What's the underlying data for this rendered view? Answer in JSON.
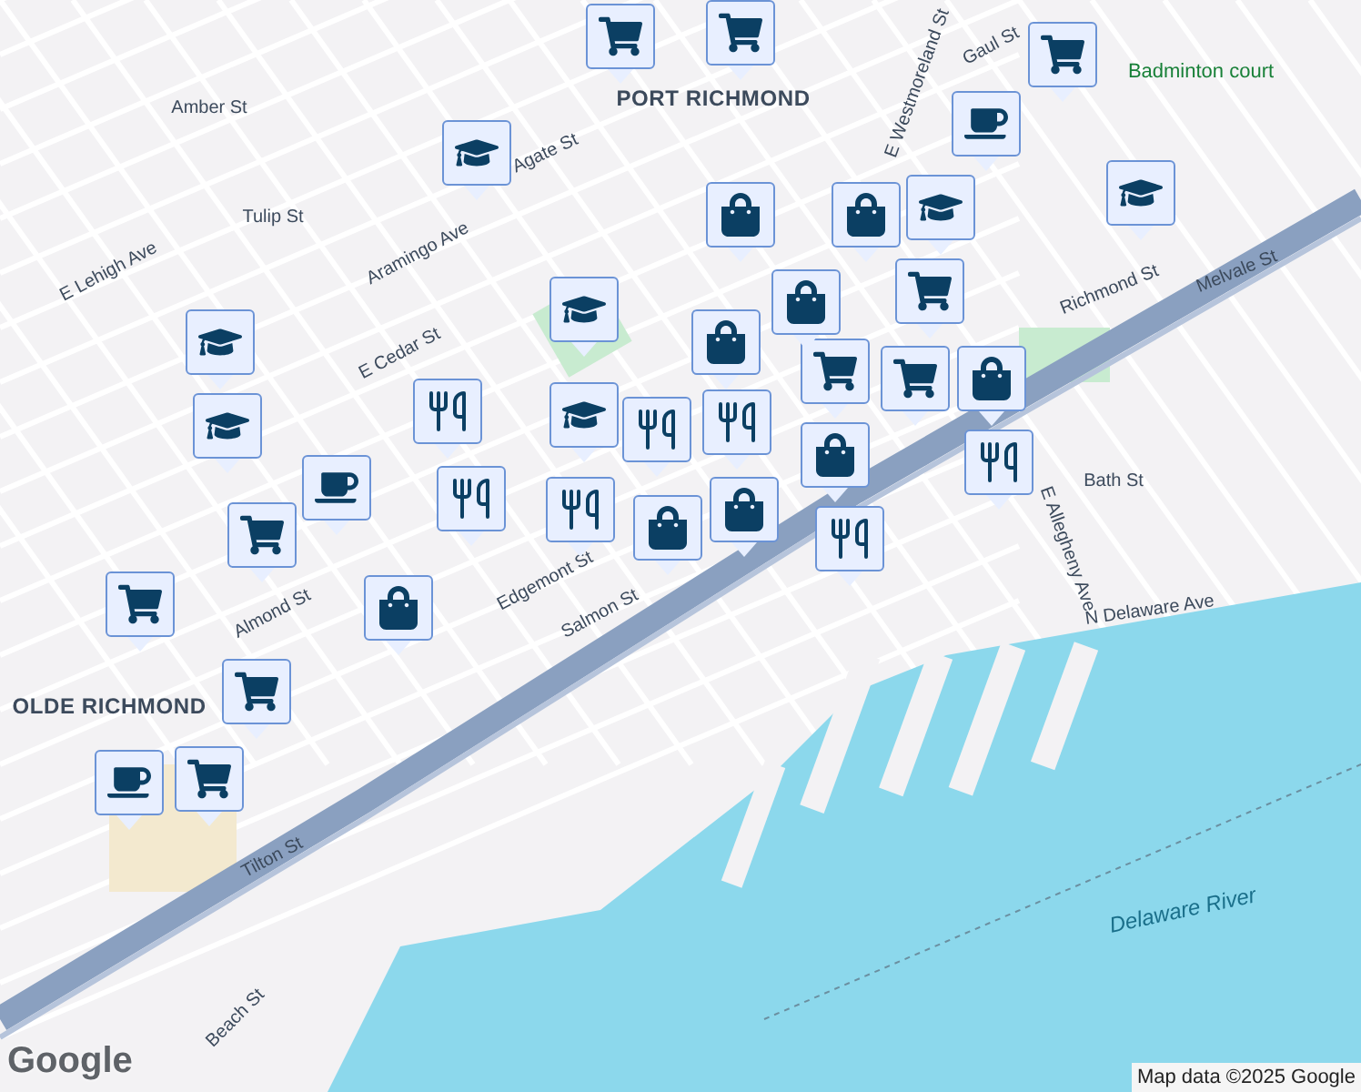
{
  "map": {
    "labels": [
      {
        "text": "PORT RICHMOND",
        "kind": "area"
      },
      {
        "text": "OLDE RICHMOND",
        "kind": "area"
      },
      {
        "text": "Delaware River",
        "kind": "water"
      },
      {
        "text": "N Delaware Ave",
        "kind": "street"
      },
      {
        "text": "Richmond St",
        "kind": "street"
      },
      {
        "text": "E Allegheny Ave",
        "kind": "street"
      },
      {
        "text": "Aramingo Ave",
        "kind": "street"
      },
      {
        "text": "E Lehigh Ave",
        "kind": "street"
      },
      {
        "text": "Badminton court",
        "kind": "poi"
      },
      {
        "text": "Bath St",
        "kind": "street"
      },
      {
        "text": "Salmon St",
        "kind": "street"
      },
      {
        "text": "Edgemont St",
        "kind": "street"
      },
      {
        "text": "Tilton St",
        "kind": "street"
      },
      {
        "text": "Beach St",
        "kind": "street"
      },
      {
        "text": "Melvale St",
        "kind": "street"
      },
      {
        "text": "E Cedar St",
        "kind": "street"
      },
      {
        "text": "Agate St",
        "kind": "street"
      },
      {
        "text": "Tulip St",
        "kind": "street"
      },
      {
        "text": "Amber St",
        "kind": "street"
      },
      {
        "text": "Almond St",
        "kind": "street"
      },
      {
        "text": "Gaul St",
        "kind": "street"
      },
      {
        "text": "E Westmoreland St",
        "kind": "street"
      }
    ]
  },
  "markers": [
    {
      "kind": "cart"
    },
    {
      "kind": "cart"
    },
    {
      "kind": "cart"
    },
    {
      "kind": "cart"
    },
    {
      "kind": "cart"
    },
    {
      "kind": "cart"
    },
    {
      "kind": "cart"
    },
    {
      "kind": "cart"
    },
    {
      "kind": "cart"
    },
    {
      "kind": "cart"
    },
    {
      "kind": "bag"
    },
    {
      "kind": "bag"
    },
    {
      "kind": "bag"
    },
    {
      "kind": "bag"
    },
    {
      "kind": "bag"
    },
    {
      "kind": "bag"
    },
    {
      "kind": "bag"
    },
    {
      "kind": "bag"
    },
    {
      "kind": "bag"
    },
    {
      "kind": "school"
    },
    {
      "kind": "school"
    },
    {
      "kind": "school"
    },
    {
      "kind": "school"
    },
    {
      "kind": "school"
    },
    {
      "kind": "school"
    },
    {
      "kind": "school"
    },
    {
      "kind": "food"
    },
    {
      "kind": "food"
    },
    {
      "kind": "food"
    },
    {
      "kind": "food"
    },
    {
      "kind": "food"
    },
    {
      "kind": "food"
    },
    {
      "kind": "food"
    },
    {
      "kind": "cafe"
    },
    {
      "kind": "cafe"
    },
    {
      "kind": "cafe"
    }
  ],
  "logo": "Google",
  "attribution": "Map data ©2025 Google"
}
